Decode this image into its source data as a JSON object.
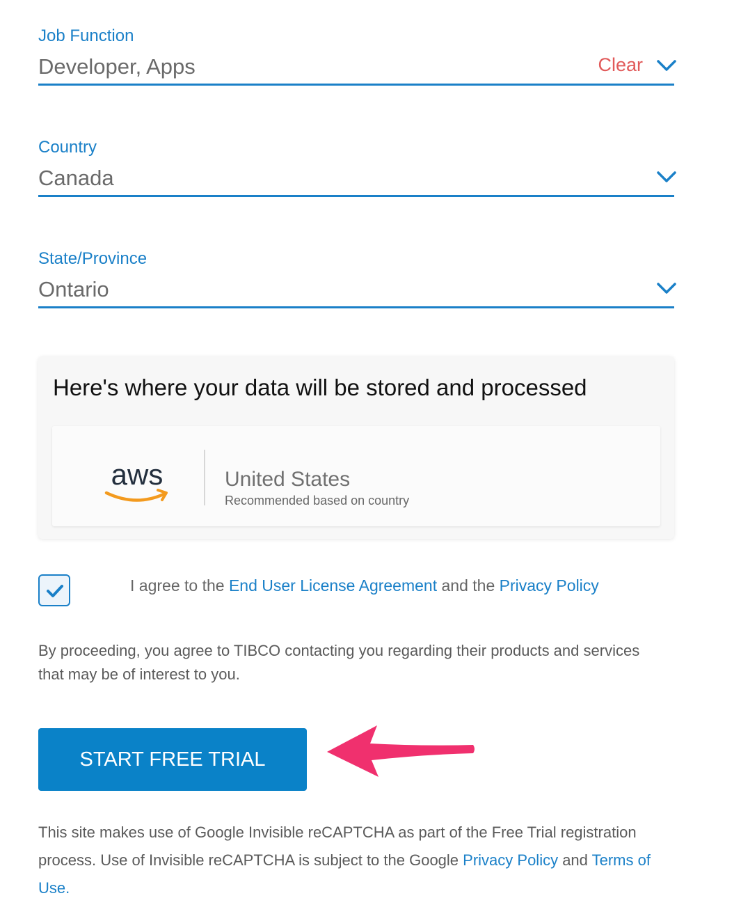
{
  "form": {
    "job_function": {
      "label": "Job Function",
      "value": "Developer, Apps",
      "clear_label": "Clear"
    },
    "country": {
      "label": "Country",
      "value": "Canada"
    },
    "state": {
      "label": "State/Province",
      "value": "Ontario"
    }
  },
  "storage": {
    "title": "Here's where your data will be stored and processed",
    "provider_logo_text": "aws",
    "region": "United States",
    "note": "Recommended based on country"
  },
  "agreement": {
    "checked": true,
    "prefix": "I agree to the ",
    "eula_link": "End User License Agreement",
    "middle": " and the ",
    "privacy_link": "Privacy Policy"
  },
  "proceed_text": "By proceeding, you agree to TIBCO contacting you regarding their products and services that may be of interest to you.",
  "cta_label": "START FREE TRIAL",
  "recaptcha": {
    "text": "This site makes use of Google Invisible reCAPTCHA as part of the Free Trial registration process. Use of Invisible reCAPTCHA is subject to the Google ",
    "privacy_link": "Privacy Policy",
    "and": " and ",
    "terms_link": "Terms of Use."
  },
  "colors": {
    "accent": "#1a80c8",
    "clear": "#e15a5a",
    "cta_bg": "#0a82c8",
    "annotation_arrow": "#f0306e"
  },
  "icons": {
    "dropdown": "chevron-down-icon",
    "checkbox": "checkmark-icon",
    "annotation": "arrow-left-icon"
  }
}
